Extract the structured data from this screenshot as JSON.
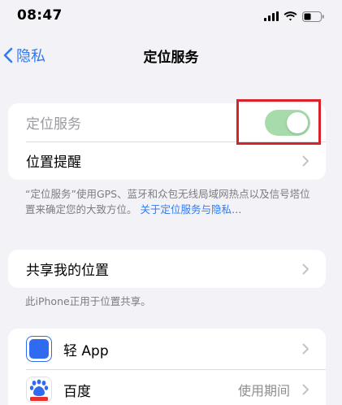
{
  "status_bar": {
    "time": "08:47",
    "signal_icon": "cellular-signal-icon",
    "wifi_icon": "wifi-icon",
    "battery_icon": "battery-icon"
  },
  "nav": {
    "back_label": "隐私",
    "title": "定位服务"
  },
  "location_card": {
    "location_services_label": "定位服务",
    "location_services_on": true,
    "location_alerts_label": "位置提醒"
  },
  "location_footnote": {
    "text": "“定位服务”使用GPS、蓝牙和众包无线局域网热点以及信号塔位置来确定您的大致方位。",
    "link": "关于定位服务与隐私…"
  },
  "share_card": {
    "share_label": "共享我的位置"
  },
  "share_footnote": {
    "text": "此iPhone正用于位置共享。"
  },
  "apps": [
    {
      "name": "轻 App",
      "value": "",
      "icon": "qing-app-icon"
    },
    {
      "name": "百度",
      "value": "使用期间",
      "icon": "baidu-app-icon"
    }
  ],
  "colors": {
    "accent": "#2f7bf5",
    "toggle_on_dimmed": "#a8dbac",
    "highlight": "#d9232a",
    "background": "#f2f2f7"
  }
}
